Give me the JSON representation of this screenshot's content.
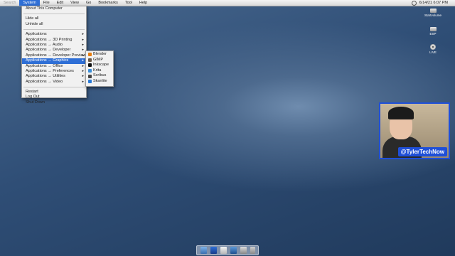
{
  "menubar": {
    "items": [
      "Search",
      "System",
      "File",
      "Edit",
      "View",
      "Go",
      "Bookmarks",
      "Tool",
      "Help"
    ],
    "clock": "6/14/21 6:07 PM"
  },
  "system_menu": {
    "group1": [
      "About This Computer"
    ],
    "group2": [
      "Hide all",
      "Unhide all"
    ],
    "group3": [
      "Applications",
      "Applications → 3D Printing",
      "Applications → Audio",
      "Applications → Developer",
      "Applications → Developer Preview",
      "Applications → Graphics",
      "Applications → Office",
      "Applications → Preferences",
      "Applications → Utilities",
      "Applications → Video"
    ],
    "group4": [
      "Restart",
      "Log Out",
      "Shut Down"
    ]
  },
  "graphics_submenu": {
    "items": [
      {
        "label": "Blender",
        "icon": "blender-icon",
        "color": "#e87d0d"
      },
      {
        "label": "GIMP",
        "icon": "gimp-icon",
        "color": "#6b5b4b"
      },
      {
        "label": "Inkscape",
        "icon": "inkscape-icon",
        "color": "#111111"
      },
      {
        "label": "Krita",
        "icon": "krita-icon",
        "color": "#3b8ed8"
      },
      {
        "label": "Scribus",
        "icon": "scribus-icon",
        "color": "#444444"
      },
      {
        "label": "Skanlite",
        "icon": "skanlite-icon",
        "color": "#2a7ad6"
      }
    ]
  },
  "desktop_icons": [
    {
      "label": "Startvolume",
      "icon": "hard-disk-icon"
    },
    {
      "label": "ESP",
      "icon": "hard-disk-icon"
    },
    {
      "label": "LIVE",
      "icon": "cd-icon"
    }
  ],
  "webcam": {
    "handle": "@TylerTechNow"
  },
  "colors": {
    "accent": "#2f6fd6",
    "overlay_border": "#1f4fd8"
  }
}
